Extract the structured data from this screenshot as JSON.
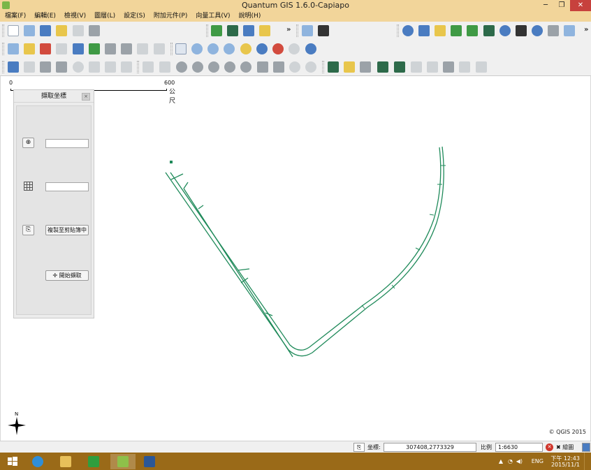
{
  "window": {
    "title": "Quantum GIS 1.6.0-Capiapo",
    "minimize_icon": "minimize-icon",
    "restore_icon": "restore-icon",
    "close_icon": "close-icon"
  },
  "menu": [
    "檔案(F)",
    "編輯(E)",
    "檢視(V)",
    "圖層(L)",
    "設定(S)",
    "附加元件(P)",
    "向量工具(V)",
    "說明(H)"
  ],
  "toolbar_overflow": "»",
  "map": {
    "scale_bar": {
      "start": "0",
      "end": "600",
      "unit": "公尺"
    },
    "copyright": "© QGIS 2015",
    "north_label": "N",
    "line_color": "#1f8a5a"
  },
  "dock": {
    "title": "擷取坐標",
    "close_label": "×",
    "copy_button": "複製至剪貼簿中",
    "start_button": "開始擷取",
    "point_value": "",
    "grid_value": ""
  },
  "status": {
    "coord_label": "坐標:",
    "coord_value": "307408,2773329",
    "scale_label": "比例",
    "scale_value": "1:6630",
    "render_label": "繪圖"
  },
  "taskbar": {
    "apps": [
      "start-icon",
      "ie-icon",
      "file-explorer-icon",
      "store-icon",
      "qgis-icon",
      "word-icon"
    ],
    "lang": "ENG",
    "time": "下午 12:43",
    "date": "2015/11/1"
  },
  "colors": {
    "titlebar": "#f2d59a",
    "taskbar": "#9a6a18",
    "close": "#c7413d",
    "road": "#1f8a5a"
  }
}
